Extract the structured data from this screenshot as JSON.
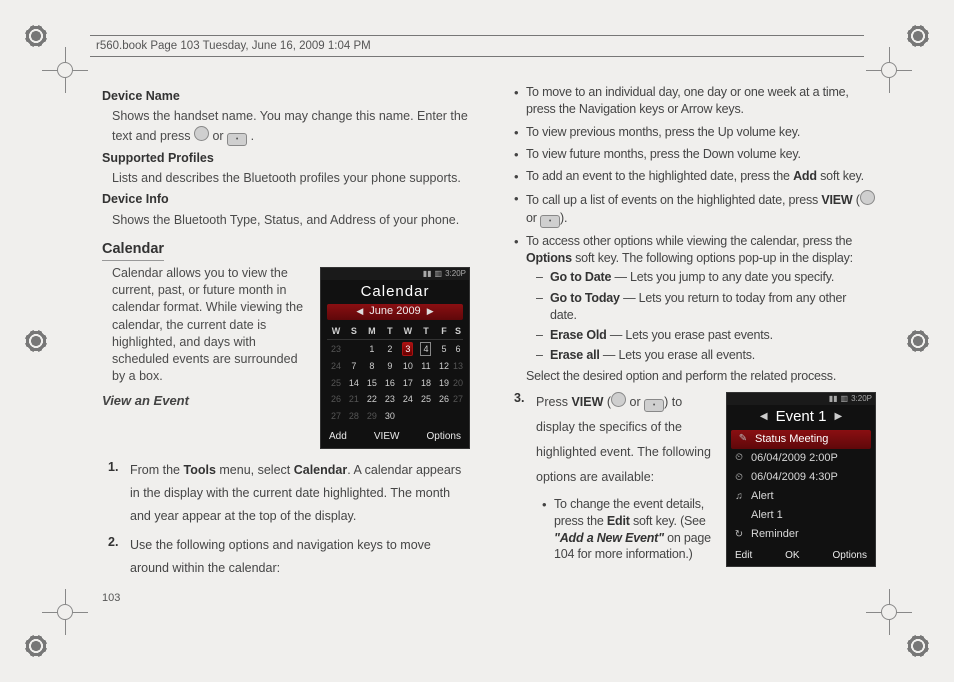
{
  "header": "r560.book  Page 103  Tuesday, June 16, 2009  1:04 PM",
  "page_number": "103",
  "left": {
    "h_device_name": "Device Name",
    "p_device_name_a": "Shows the handset name. You may change this name. Enter the text and press ",
    "p_device_name_b": " or ",
    "p_device_name_c": ".",
    "h_supported_profiles": "Supported Profiles",
    "p_supported_profiles": "Lists and describes the Bluetooth profiles your phone supports.",
    "h_device_info": "Device Info",
    "p_device_info": "Shows the Bluetooth Type, Status, and Address of your phone.",
    "h_calendar": "Calendar",
    "p_calendar": "Calendar allows you to view the current, past, or future month in calendar format. While viewing the calendar, the current date is highlighted, and days with scheduled events are surrounded by a box.",
    "h_view_event": "View an Event",
    "step1_a": "From the ",
    "step1_tools": "Tools",
    "step1_b": " menu, select ",
    "step1_cal": "Calendar",
    "step1_c": ". A calendar appears in the display with the current date highlighted. The month and year appear at the top of the display.",
    "step2": "Use the following options and navigation keys to move around within the calendar:"
  },
  "phone_cal": {
    "clock": "3:20P",
    "title": "Calendar",
    "month": "June 2009",
    "dow": [
      "W",
      "S",
      "M",
      "T",
      "W",
      "T",
      "F",
      "S"
    ],
    "rows": [
      {
        "wk": "23",
        "d": [
          "",
          "1",
          "2",
          "3",
          "4",
          "5",
          "6"
        ],
        "dim": [
          0
        ],
        "sel": 3,
        "box": 4
      },
      {
        "wk": "24",
        "d": [
          "7",
          "8",
          "9",
          "10",
          "11",
          "12",
          "13"
        ],
        "dim": [
          6
        ]
      },
      {
        "wk": "25",
        "d": [
          "14",
          "15",
          "16",
          "17",
          "18",
          "19",
          "20"
        ],
        "dim": [
          6
        ]
      },
      {
        "wk": "26",
        "d": [
          "21",
          "22",
          "23",
          "24",
          "25",
          "26",
          "27"
        ],
        "dim": [
          0,
          6
        ]
      },
      {
        "wk": "27",
        "d": [
          "28",
          "29",
          "30",
          "",
          "",
          "",
          ""
        ],
        "dim": [
          0,
          1
        ]
      }
    ],
    "soft_left": "Add",
    "soft_center": "VIEW",
    "soft_right": "Options"
  },
  "right": {
    "b1": "To move to an individual day, one day or one week at a time, press the Navigation keys or Arrow keys.",
    "b2": "To view previous months, press the Up volume key.",
    "b3": "To view future months, press the Down volume key.",
    "b4_a": "To add an event to the highlighted date, press the ",
    "b4_add": "Add",
    "b4_b": " soft key.",
    "b5_a": "To call up a list of events on the highlighted date, press ",
    "b5_view": "VIEW",
    "b5_b": " (",
    "b5_c": " or ",
    "b5_d": ").",
    "b6_a": "To access other options while viewing the calendar, press the ",
    "b6_opt": "Options",
    "b6_b": " soft key. The following options pop-up in the display:",
    "d1_b": "Go to Date",
    "d1_t": " — Lets you jump to any date you specify.",
    "d2_b": "Go to Today",
    "d2_t": " — Lets you return to today from any other date.",
    "d3_b": "Erase Old",
    "d3_t": " — Lets you erase past events.",
    "d4_b": "Erase all",
    "d4_t": " — Lets you erase all events.",
    "after_dash": "Select the desired option and perform the related process.",
    "s3_a": "Press ",
    "s3_view": "VIEW",
    "s3_b": " (",
    "s3_c": " or ",
    "s3_d": ") to display the specifics of the highlighted event. The following options are available:",
    "s3_bul_a": "To change the event details, press the ",
    "s3_bul_edit": "Edit",
    "s3_bul_b": " soft key. (See ",
    "s3_bul_ref": "\"Add a New Event\"",
    "s3_bul_c": " on page 104 for more information.)"
  },
  "phone_evt": {
    "clock": "3:20P",
    "title": "Event 1",
    "rows": [
      {
        "ico": "✎",
        "label": "Status Meeting",
        "hl": true
      },
      {
        "ico": "⏲",
        "label": "06/04/2009 2:00P"
      },
      {
        "ico": "⏲",
        "label": "06/04/2009 4:30P"
      },
      {
        "ico": "♫",
        "label": "Alert"
      },
      {
        "ico": "",
        "label": "Alert 1"
      },
      {
        "ico": "↻",
        "label": "Reminder"
      }
    ],
    "soft_left": "Edit",
    "soft_center": "OK",
    "soft_right": "Options"
  }
}
